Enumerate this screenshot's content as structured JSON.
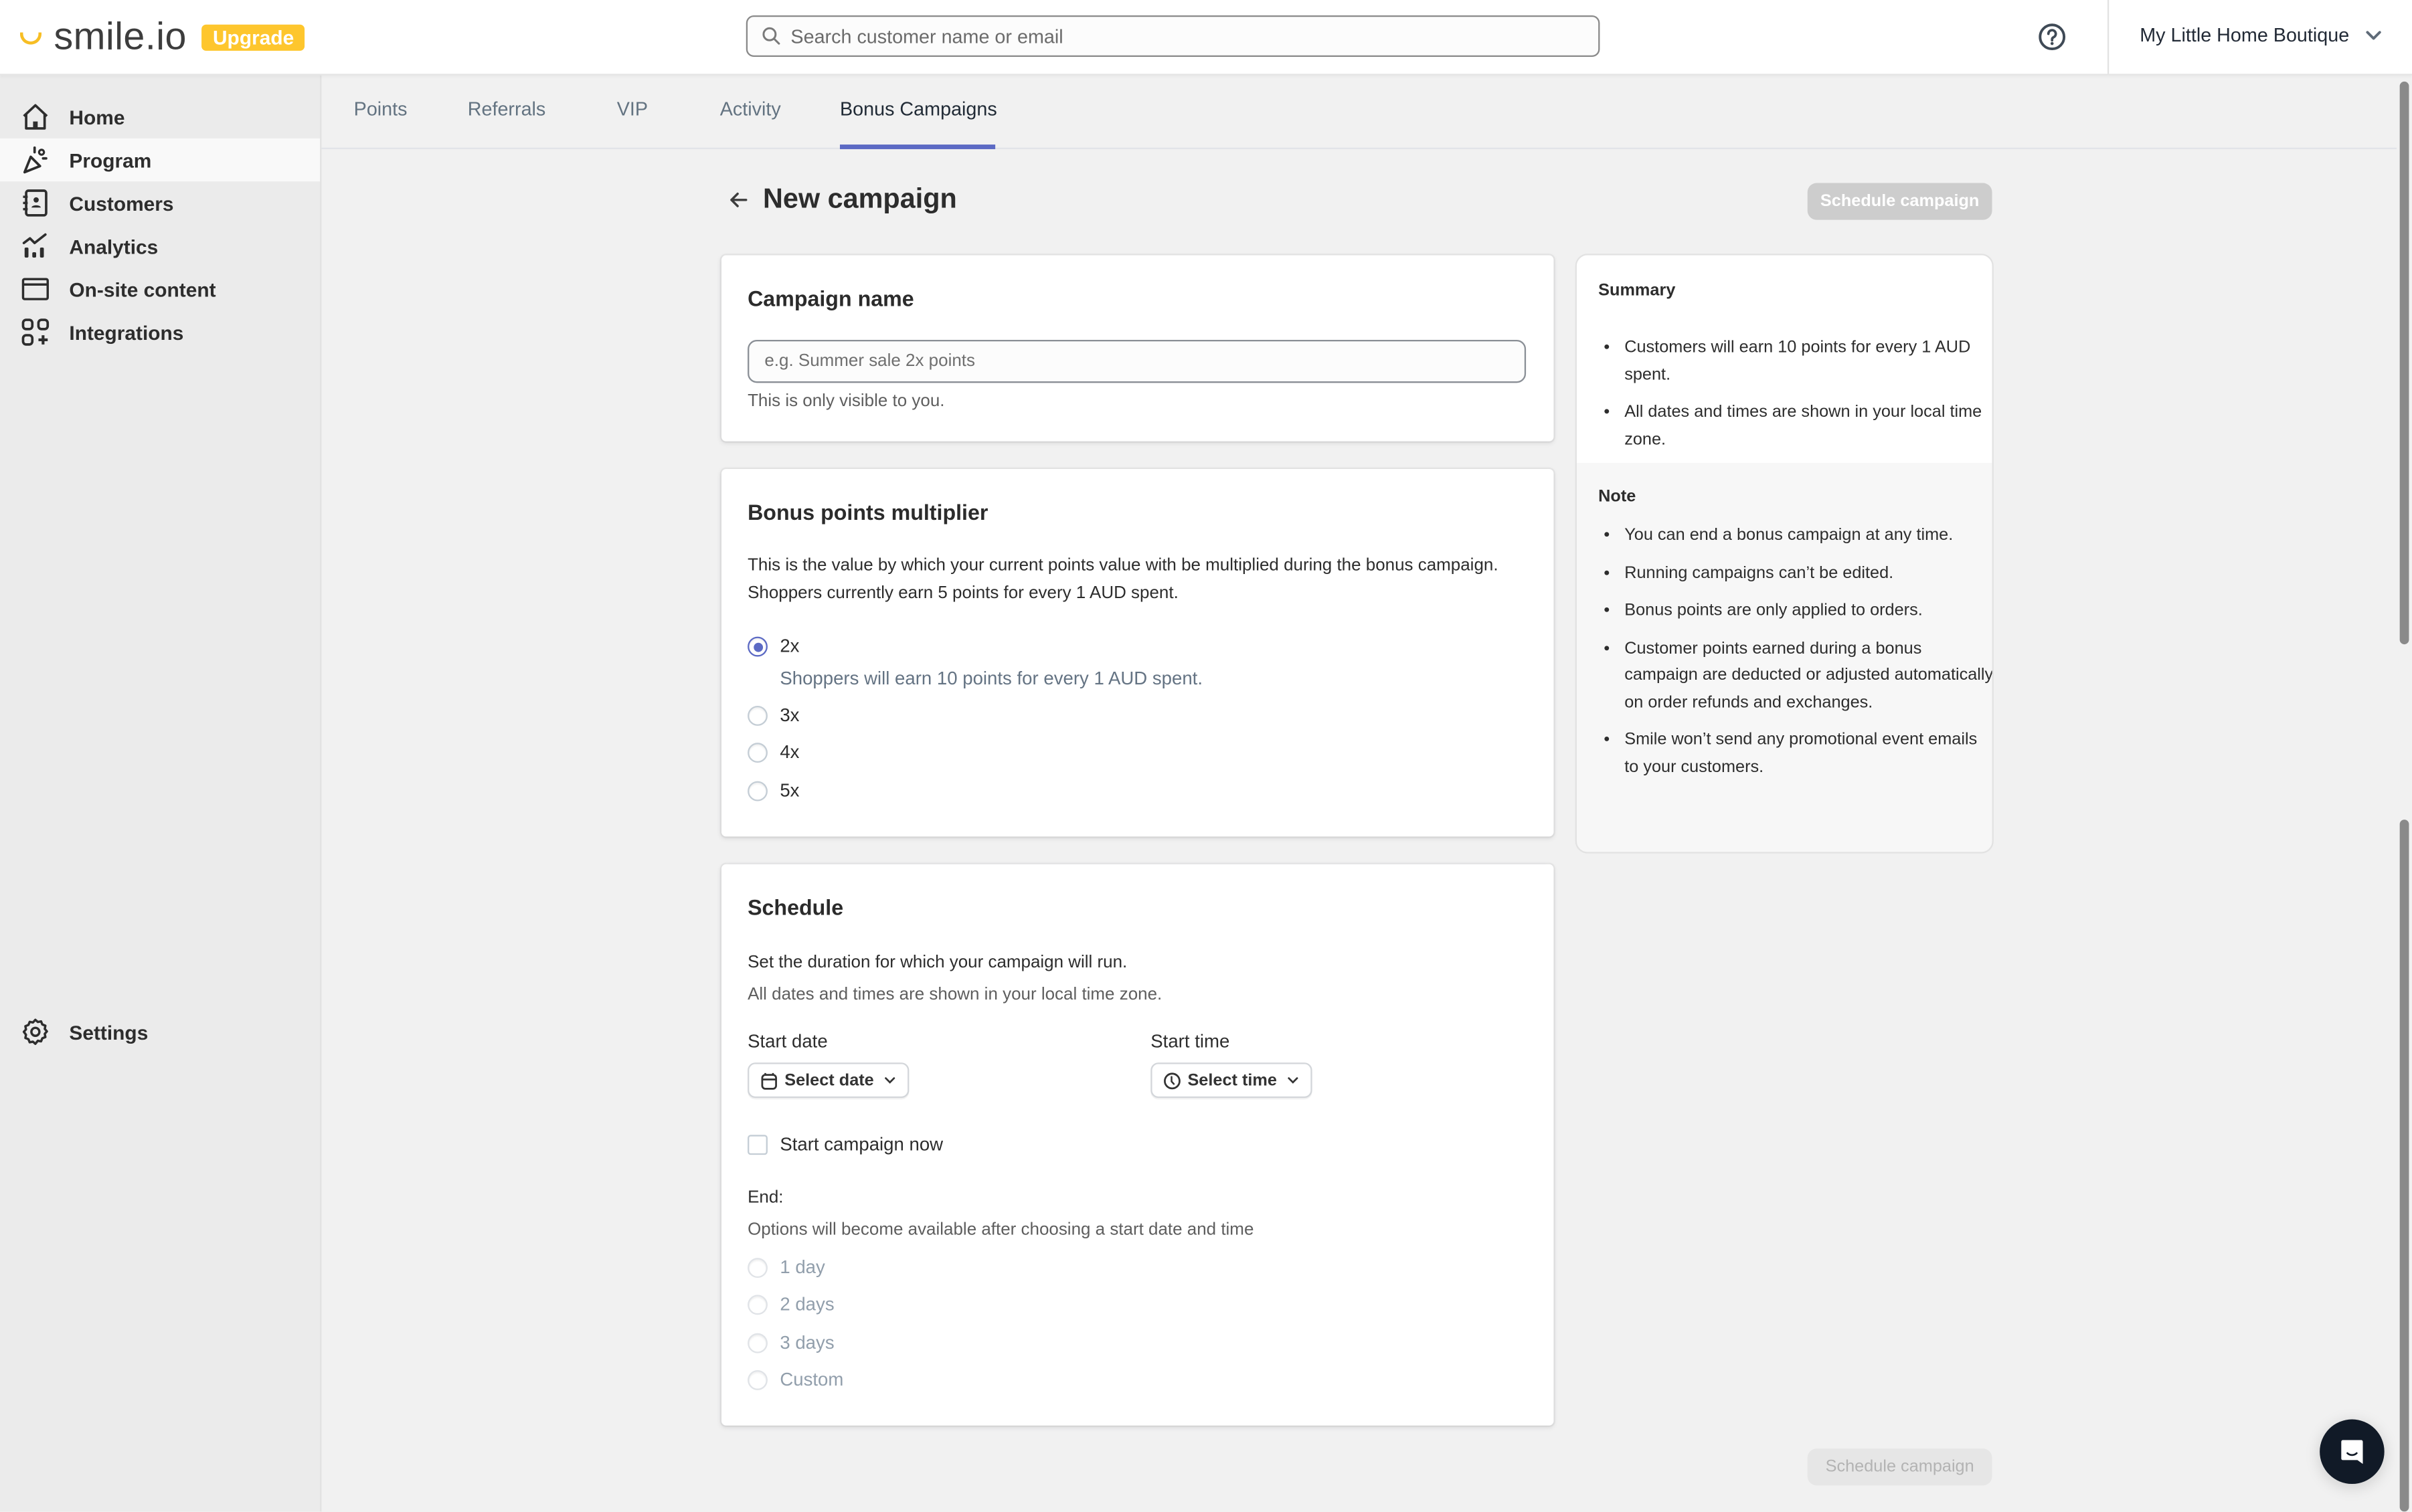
{
  "header": {
    "logo_text": "smile.io",
    "upgrade_label": "Upgrade",
    "search_placeholder": "Search customer name or email",
    "search_value": "",
    "store_name": "My Little Home Boutique"
  },
  "sidebar": {
    "items": [
      {
        "label": "Home",
        "icon": "home-icon"
      },
      {
        "label": "Program",
        "icon": "party-popper-icon",
        "active": true
      },
      {
        "label": "Customers",
        "icon": "contacts-book-icon"
      },
      {
        "label": "Analytics",
        "icon": "analytics-icon"
      },
      {
        "label": "On-site content",
        "icon": "browser-window-icon"
      },
      {
        "label": "Integrations",
        "icon": "apps-add-icon"
      }
    ],
    "settings_label": "Settings"
  },
  "tabs": [
    {
      "label": "Points"
    },
    {
      "label": "Referrals"
    },
    {
      "label": "VIP"
    },
    {
      "label": "Activity"
    },
    {
      "label": "Bonus Campaigns",
      "active": true
    }
  ],
  "page": {
    "title": "New campaign",
    "schedule_button_label": "Schedule campaign"
  },
  "campaign_name": {
    "title": "Campaign name",
    "placeholder": "e.g. Summer sale 2x points",
    "value": "",
    "help": "This is only visible to you."
  },
  "multiplier": {
    "title": "Bonus points multiplier",
    "description": "This is the value by which your current points value with be multiplied during the bonus campaign. Shoppers currently earn 5 points for every 1 AUD spent.",
    "options": [
      {
        "label": "2x",
        "checked": true,
        "help": "Shoppers will earn 10 points for every 1 AUD spent."
      },
      {
        "label": "3x",
        "checked": false
      },
      {
        "label": "4x",
        "checked": false
      },
      {
        "label": "5x",
        "checked": false
      }
    ]
  },
  "schedule": {
    "title": "Schedule",
    "description": "Set the duration for which your campaign will run.",
    "timezone_note": "All dates and times are shown in your local time zone.",
    "start_date_label": "Start date",
    "start_date_value": "Select date",
    "start_time_label": "Start time",
    "start_time_value": "Select time",
    "start_now_label": "Start campaign now",
    "start_now_checked": false,
    "end_label": "End:",
    "end_note": "Options will become available after choosing a start date and time",
    "end_options": [
      {
        "label": "1 day",
        "disabled": true
      },
      {
        "label": "2 days",
        "disabled": true
      },
      {
        "label": "3 days",
        "disabled": true
      },
      {
        "label": "Custom",
        "disabled": true
      }
    ]
  },
  "summary": {
    "title": "Summary",
    "items": [
      "Customers will earn 10 points for every 1 AUD spent.",
      "All dates and times are shown in your local time zone."
    ],
    "note_title": "Note",
    "notes": [
      "You can end a bonus campaign at any time.",
      "Running campaigns can’t be edited.",
      "Bonus points are only applied to orders.",
      "Customer points earned during a bonus campaign are deducted or adjusted automatically on order refunds and exchanges.",
      "Smile won’t send any promotional event emails to your customers."
    ]
  },
  "colors": {
    "brand_yellow": "#fec62d",
    "accent_indigo": "#5c6ac4",
    "disabled_button": "#cdcdcd",
    "chat_button": "#111a27"
  }
}
